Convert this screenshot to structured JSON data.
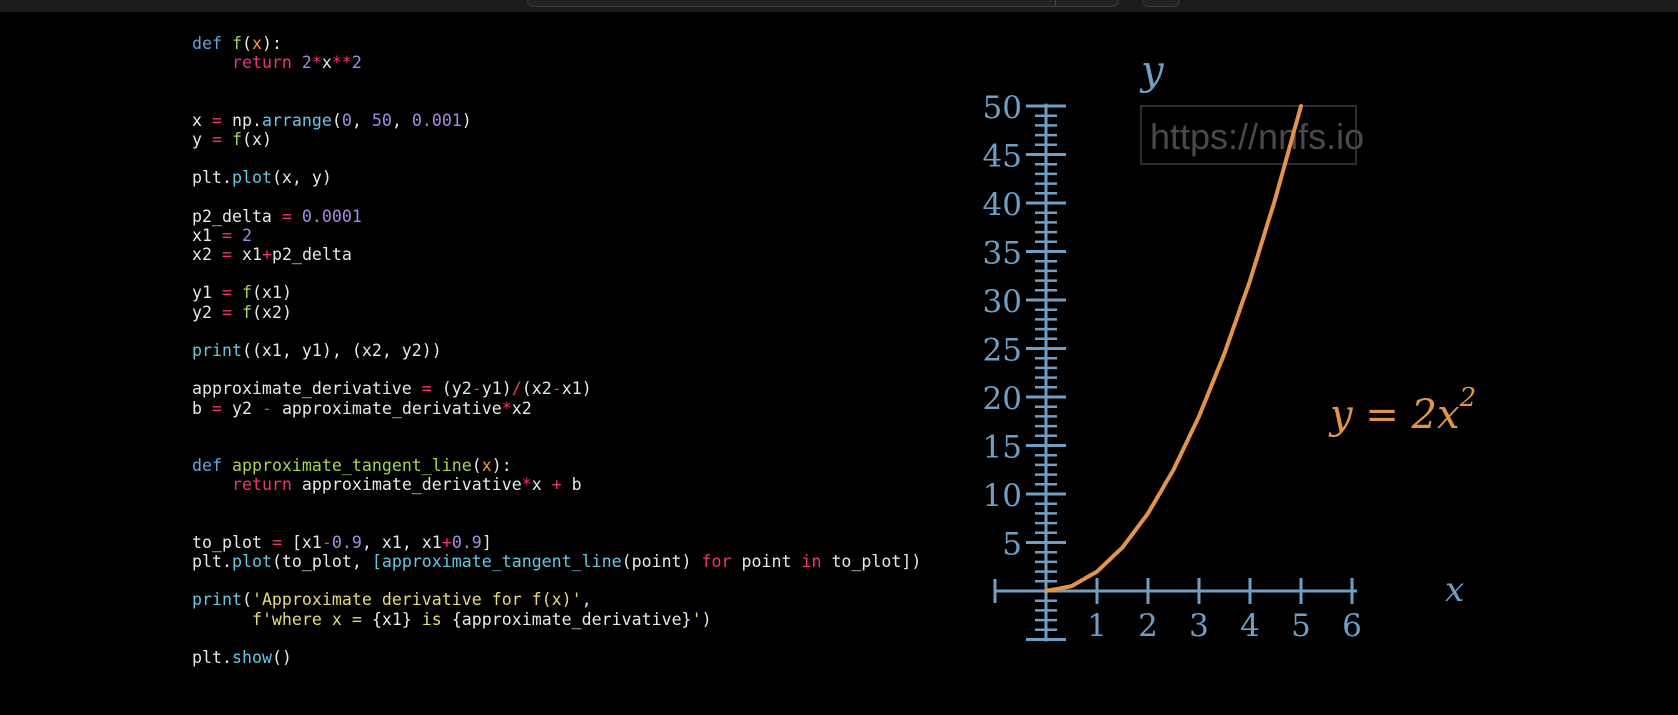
{
  "code_lines": [
    [
      {
        "t": "def",
        "c": "kw"
      },
      {
        "t": " "
      },
      {
        "t": "f",
        "c": "fn"
      },
      {
        "t": "("
      },
      {
        "t": "x",
        "c": "par"
      },
      {
        "t": "):"
      }
    ],
    [
      {
        "t": "    "
      },
      {
        "t": "return",
        "c": "red"
      },
      {
        "t": " "
      },
      {
        "t": "2",
        "c": "num"
      },
      {
        "t": "*",
        "c": "op"
      },
      {
        "t": "x"
      },
      {
        "t": "**",
        "c": "op"
      },
      {
        "t": "2",
        "c": "num"
      }
    ],
    [],
    [],
    [
      {
        "t": "x "
      },
      {
        "t": "=",
        "c": "op"
      },
      {
        "t": " np."
      },
      {
        "t": "arrange",
        "c": "bi"
      },
      {
        "t": "("
      },
      {
        "t": "0",
        "c": "num"
      },
      {
        "t": ", "
      },
      {
        "t": "50",
        "c": "num"
      },
      {
        "t": ", "
      },
      {
        "t": "0.001",
        "c": "num"
      },
      {
        "t": ")"
      }
    ],
    [
      {
        "t": "y "
      },
      {
        "t": "=",
        "c": "op"
      },
      {
        "t": " "
      },
      {
        "t": "f",
        "c": "fn"
      },
      {
        "t": "(x)"
      }
    ],
    [],
    [
      {
        "t": "plt."
      },
      {
        "t": "plot",
        "c": "bi"
      },
      {
        "t": "(x, y)"
      }
    ],
    [],
    [
      {
        "t": "p2_delta "
      },
      {
        "t": "=",
        "c": "op"
      },
      {
        "t": " "
      },
      {
        "t": "0.0001",
        "c": "num"
      }
    ],
    [
      {
        "t": "x1 "
      },
      {
        "t": "=",
        "c": "op"
      },
      {
        "t": " "
      },
      {
        "t": "2",
        "c": "num"
      }
    ],
    [
      {
        "t": "x2 "
      },
      {
        "t": "=",
        "c": "op"
      },
      {
        "t": " x1"
      },
      {
        "t": "+",
        "c": "op"
      },
      {
        "t": "p2_delta"
      }
    ],
    [],
    [
      {
        "t": "y1 "
      },
      {
        "t": "=",
        "c": "op"
      },
      {
        "t": " "
      },
      {
        "t": "f",
        "c": "fn"
      },
      {
        "t": "(x1)"
      }
    ],
    [
      {
        "t": "y2 "
      },
      {
        "t": "=",
        "c": "op"
      },
      {
        "t": " "
      },
      {
        "t": "f",
        "c": "fn"
      },
      {
        "t": "(x2)"
      }
    ],
    [],
    [
      {
        "t": "print",
        "c": "bi"
      },
      {
        "t": "((x1, y1), (x2, y2))"
      }
    ],
    [],
    [
      {
        "t": "approximate_derivative "
      },
      {
        "t": "=",
        "c": "op"
      },
      {
        "t": " (y2"
      },
      {
        "t": "-",
        "c": "op"
      },
      {
        "t": "y1)"
      },
      {
        "t": "/",
        "c": "op"
      },
      {
        "t": "(x2"
      },
      {
        "t": "-",
        "c": "op"
      },
      {
        "t": "x1)"
      }
    ],
    [
      {
        "t": "b "
      },
      {
        "t": "=",
        "c": "op"
      },
      {
        "t": " y2 "
      },
      {
        "t": "-",
        "c": "op"
      },
      {
        "t": " approximate_derivative"
      },
      {
        "t": "*",
        "c": "op"
      },
      {
        "t": "x2"
      }
    ],
    [],
    [],
    [
      {
        "t": "def",
        "c": "kw"
      },
      {
        "t": " "
      },
      {
        "t": "approximate_tangent_line",
        "c": "fn"
      },
      {
        "t": "("
      },
      {
        "t": "x",
        "c": "par"
      },
      {
        "t": "):"
      }
    ],
    [
      {
        "t": "    "
      },
      {
        "t": "return",
        "c": "red"
      },
      {
        "t": " approximate_derivative"
      },
      {
        "t": "*",
        "c": "op"
      },
      {
        "t": "x "
      },
      {
        "t": "+",
        "c": "op"
      },
      {
        "t": " b"
      }
    ],
    [],
    [],
    [
      {
        "t": "to_plot "
      },
      {
        "t": "=",
        "c": "op"
      },
      {
        "t": " [x1"
      },
      {
        "t": "-",
        "c": "op"
      },
      {
        "t": "0.9",
        "c": "num"
      },
      {
        "t": ", x1, x1"
      },
      {
        "t": "+",
        "c": "op"
      },
      {
        "t": "0.9",
        "c": "num"
      },
      {
        "t": "]"
      }
    ],
    [
      {
        "t": "plt."
      },
      {
        "t": "plot",
        "c": "bi"
      },
      {
        "t": "(to_plot, "
      },
      {
        "t": "[approximate_tangent_line",
        "c": "bi"
      },
      {
        "t": "(point) "
      },
      {
        "t": "for",
        "c": "red"
      },
      {
        "t": " point "
      },
      {
        "t": "in",
        "c": "red"
      },
      {
        "t": " to_plot])"
      }
    ],
    [],
    [
      {
        "t": "print",
        "c": "bi"
      },
      {
        "t": "("
      },
      {
        "t": "'Approximate derivative for f(x)'",
        "c": "str"
      },
      {
        "t": ","
      }
    ],
    [
      {
        "t": "      "
      },
      {
        "t": "f'where x = ",
        "c": "str"
      },
      {
        "t": "{x1}"
      },
      {
        "t": " is ",
        "c": "str"
      },
      {
        "t": "{approximate_derivative}"
      },
      {
        "t": "'",
        "c": "str"
      },
      {
        "t": ")"
      }
    ],
    [],
    [
      {
        "t": "plt."
      },
      {
        "t": "show",
        "c": "bi"
      },
      {
        "t": "()"
      }
    ]
  ],
  "colors": {
    "keyword": "#5fa6e0",
    "function": "#a6d64e",
    "operator": "#f0337b",
    "number": "#a48ce0",
    "parameter": "#f39b2b",
    "string": "#e6db74",
    "builtin": "#66c7e0",
    "axis": "#6f9fc4",
    "curve": "#e0954a"
  },
  "graph": {
    "watermark": "https://nnfs.io",
    "y_axis_label": "y",
    "x_axis_label": "x",
    "equation": {
      "lhs": "y = 2x",
      "exp": "2"
    }
  },
  "chart_data": {
    "type": "line",
    "series": [
      {
        "name": "y = 2x²",
        "x": [
          0,
          0.5,
          1,
          1.5,
          2,
          2.5,
          3,
          3.5,
          4,
          4.5,
          5
        ],
        "y": [
          0,
          0.5,
          2,
          4.5,
          8,
          12.5,
          18,
          24.5,
          32,
          40.5,
          50
        ]
      }
    ],
    "xticks": [
      "1",
      "2",
      "3",
      "4",
      "5",
      "6"
    ],
    "yticks": [
      "5",
      "10",
      "15",
      "20",
      "25",
      "30",
      "35",
      "40",
      "45",
      "50"
    ],
    "xlim": [
      -1,
      6
    ],
    "ylim": [
      -5,
      50
    ],
    "xlabel": "x",
    "ylabel": "y",
    "grid": false
  }
}
